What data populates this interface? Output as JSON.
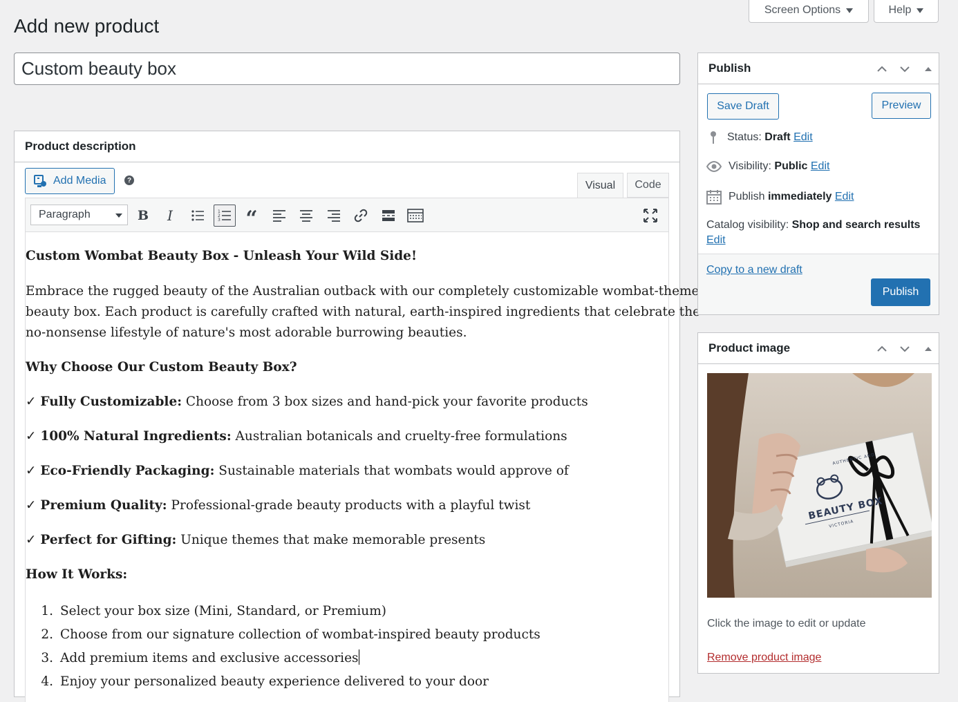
{
  "screen_meta": {
    "screen_options": "Screen Options",
    "help": "Help"
  },
  "page_title": "Add new product",
  "product_title": "Custom beauty box",
  "description_box": {
    "heading": "Product description",
    "add_media": "Add Media",
    "help_icon": "?",
    "tabs": [
      "Visual",
      "Code"
    ],
    "active_tab": "Visual",
    "format_select": "Paragraph",
    "toolbar_icons": [
      "bold-icon",
      "italic-icon",
      "bulleted-list-icon",
      "numbered-list-icon",
      "blockquote-icon",
      "align-left-icon",
      "align-center-icon",
      "align-right-icon",
      "link-icon",
      "read-more-icon",
      "toolbar-toggle-icon",
      "fullscreen-icon"
    ]
  },
  "content": {
    "heading": "Custom Wombat Beauty Box - Unleash Your Wild Side!",
    "intro_lines": [
      "Embrace the rugged beauty of the Australian outback with our completely customizable wombat-themed",
      "beauty box. Each product is carefully crafted with natural, earth-inspired ingredients that celebrate the",
      "no-nonsense lifestyle of nature's most adorable burrowing beauties."
    ],
    "why_heading": "Why Choose Our Custom Beauty Box?",
    "check_mark": "✓",
    "features": [
      {
        "title": "Fully Customizable:",
        "text": " Choose from 3 box sizes and hand-pick your favorite products"
      },
      {
        "title": "100% Natural Ingredients:",
        "text": " Australian botanicals and cruelty-free formulations"
      },
      {
        "title": "Eco-Friendly Packaging:",
        "text": " Sustainable materials that wombats would approve of"
      },
      {
        "title": "Premium Quality:",
        "text": " Professional-grade beauty products with a playful twist"
      },
      {
        "title": "Perfect for Gifting:",
        "text": " Unique themes that make memorable presents"
      }
    ],
    "how_heading": "How It Works:",
    "steps": [
      {
        "num": "1.",
        "text": "Select your box size (Mini, Standard, or Premium)"
      },
      {
        "num": "2.",
        "text": "Choose from our signature collection of wombat-inspired beauty products"
      },
      {
        "num": "3.",
        "text": "Add premium items and exclusive accessories"
      },
      {
        "num": "4.",
        "text": "Enjoy your personalized beauty experience delivered to your door"
      }
    ]
  },
  "publish": {
    "heading": "Publish",
    "save_draft": "Save Draft",
    "preview": "Preview",
    "status_label": "Status:",
    "status_value": "Draft",
    "visibility_label": "Visibility:",
    "visibility_value": "Public",
    "publish_label": "Publish",
    "publish_value": "immediately",
    "catalog_label": "Catalog visibility:",
    "catalog_value": "Shop and search results",
    "edit": "Edit",
    "copy_draft": "Copy to a new draft",
    "publish_button": "Publish"
  },
  "product_image": {
    "heading": "Product image",
    "box_brand": "BEAUTY BOX",
    "box_sub": "VICTORIA",
    "box_arc": "AUTHENTIC AND",
    "hint": "Click the image to edit or update",
    "remove": "Remove product image"
  },
  "colors": {
    "accent": "#2271b1",
    "danger": "#b32d2e",
    "background": "#f0f0f1"
  }
}
